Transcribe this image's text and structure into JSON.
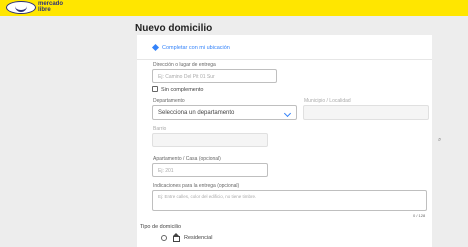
{
  "header": {
    "logo_text": "mercado\nlibre"
  },
  "page": {
    "title": "Nuevo domicilio"
  },
  "form": {
    "location_link": "Completar con mi ubicación",
    "street": {
      "label": "Dirección o lugar de entrega",
      "placeholder": "Ej: Camino Del Pit 01 Sur"
    },
    "no_number": {
      "label": "Sin complemento"
    },
    "department": {
      "label": "Departamento",
      "value": "Selecciona un departamento"
    },
    "locality": {
      "label": "Municipio / Localidad"
    },
    "barrio": {
      "label": "Barrio"
    },
    "apartment": {
      "label": "Apartamento / Casa (opcional)",
      "placeholder": "Ej: 201"
    },
    "instructions": {
      "label": "Indicaciones para la entrega (opcional)",
      "placeholder": "Ej: Entre calles, color del edificio, no tiene timbre.",
      "counter": "0 / 128"
    },
    "address_type": {
      "label": "Tipo de domicilio",
      "option": "Residencial"
    }
  }
}
